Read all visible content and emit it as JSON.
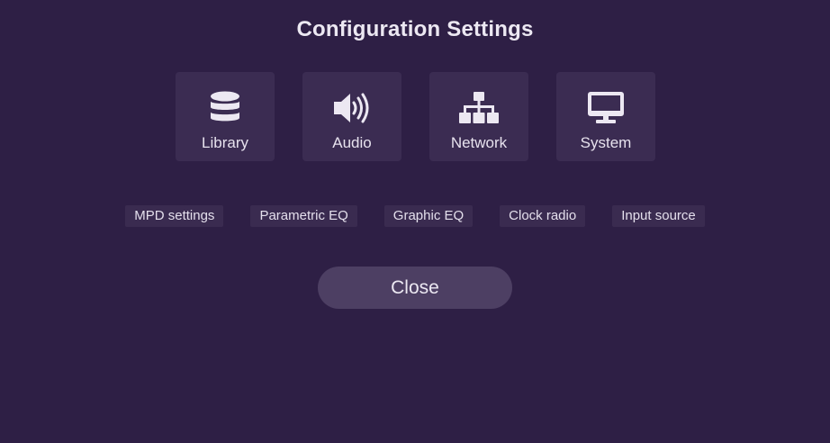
{
  "dialog": {
    "title": "Configuration Settings"
  },
  "tiles": [
    {
      "label": "Library",
      "icon": "database-icon"
    },
    {
      "label": "Audio",
      "icon": "speaker-icon"
    },
    {
      "label": "Network",
      "icon": "sitemap-icon"
    },
    {
      "label": "System",
      "icon": "desktop-icon"
    }
  ],
  "links": [
    {
      "label": "MPD settings"
    },
    {
      "label": "Parametric EQ"
    },
    {
      "label": "Graphic EQ"
    },
    {
      "label": "Clock radio"
    },
    {
      "label": "Input source"
    }
  ],
  "footer": {
    "close_label": "Close"
  },
  "colors": {
    "background": "#2e1f45",
    "tile": "#3b2c52",
    "button": "#4d3f63",
    "text": "#ece8f2"
  }
}
